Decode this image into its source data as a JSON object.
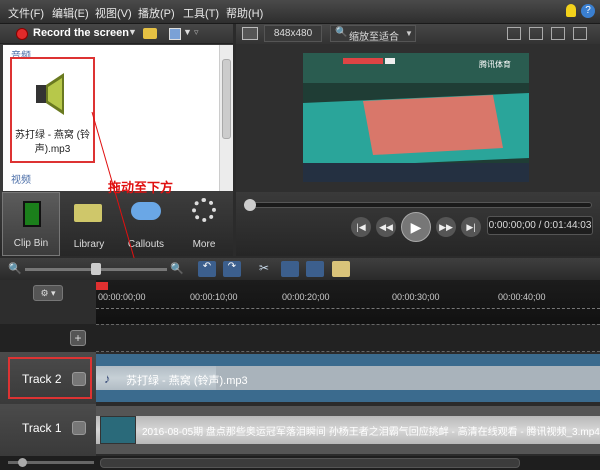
{
  "menubar": {
    "items": [
      "文件(F)",
      "编辑(E)",
      "视图(V)",
      "播放(P)",
      "工具(T)",
      "帮助(H)"
    ],
    "help_icon": "lightbulb-icon",
    "help2_icon": "help-icon"
  },
  "recorder": {
    "label": "Record the screen"
  },
  "clip_bin": {
    "audio_section": "音频",
    "video_section": "视频",
    "media_item_name": "苏打绿 - 燕窝 (铃声).mp3"
  },
  "tabs": [
    {
      "label": "Clip Bin",
      "icon": "film-icon"
    },
    {
      "label": "Library",
      "icon": "folder-icon"
    },
    {
      "label": "Callouts",
      "icon": "speech-bubble-icon"
    },
    {
      "label": "More",
      "icon": "spinner-icon"
    }
  ],
  "preview": {
    "dimensions": "848x480",
    "zoom": "缩放至适合",
    "video_overlay": "腾讯体育"
  },
  "playback": {
    "time": "0:00:00;00 / 0:01:44:03",
    "progress": 0.0
  },
  "annotation": {
    "text": "拖动至下方",
    "color": "#e01010"
  },
  "timeline": {
    "ticks": [
      "00:00:00;00",
      "00:00:10;00",
      "00:00:20;00",
      "00:00:30;00",
      "00:00:40;00"
    ],
    "add_track_symbol": "+"
  },
  "tracks": [
    {
      "label": "Track 2",
      "clip": "苏打绿 - 燕窝 (铃声).mp3"
    },
    {
      "label": "Track 1",
      "clip": "2016-08-05期 盘点那些奥运冠军落泪瞬间 孙杨王者之泪霸气回应挑衅 - 高清在线观看 - 腾讯视频_3.mp4"
    }
  ],
  "colors": {
    "highlight": "#dd2222",
    "accent": "#4b6ea8"
  }
}
